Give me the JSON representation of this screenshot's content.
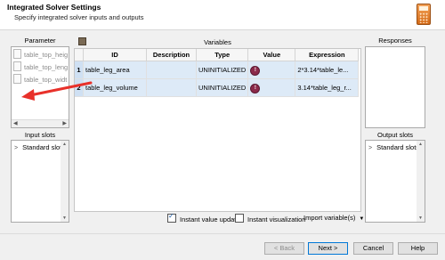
{
  "header": {
    "title": "Integrated Solver Settings",
    "subtitle": "Specify integrated solver inputs and outputs",
    "icon": "calculator-icon"
  },
  "parameter_panel": {
    "label": "Parameter",
    "items": [
      "table_top_heig",
      "table_top_leng",
      "table_top_widt"
    ]
  },
  "input_slots": {
    "label": "Input slots",
    "items": [
      "Standard slots"
    ]
  },
  "variables": {
    "label": "Variables",
    "columns": [
      "ID",
      "Description",
      "Type",
      "Value",
      "Expression"
    ],
    "rows": [
      {
        "num": "1",
        "id": "table_leg_area",
        "description": "",
        "type": "UNINITIALIZED",
        "value_icon": "warning-icon",
        "expression": "2*3.14*table_le..."
      },
      {
        "num": "2",
        "id": "table_leg_volume",
        "description": "",
        "type": "UNINITIALIZED",
        "value_icon": "warning-icon",
        "expression": "3.14*table_leg_r..."
      }
    ],
    "instant_value_update": {
      "label": "Instant value update",
      "checked": true
    },
    "instant_visualization": {
      "label": "Instant visualization",
      "checked": false
    },
    "import_label": "Import variable(s)"
  },
  "responses": {
    "label": "Responses",
    "items": []
  },
  "output_slots": {
    "label": "Output slots",
    "items": [
      "Standard slots"
    ]
  },
  "buttons": {
    "back": "< Back",
    "next": "Next >",
    "cancel": "Cancel",
    "help": "Help"
  },
  "colors": {
    "selection_row": "#ddeaf7",
    "row_header": "#cfe0f3",
    "annotation_arrow": "#e8312a",
    "warning": "#8c2a4a"
  }
}
